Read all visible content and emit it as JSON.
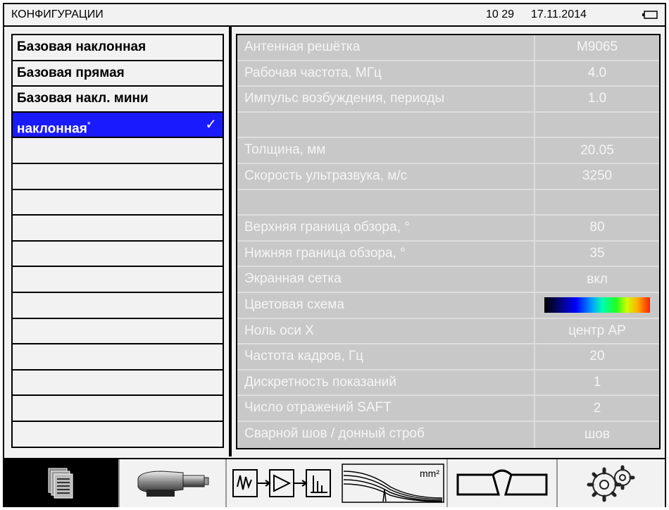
{
  "header": {
    "title": "КОНФИГУРАЦИИ",
    "time": "10 29",
    "date": "17.11.2014"
  },
  "configs": [
    {
      "label": "Базовая наклонная",
      "star": "",
      "check": ""
    },
    {
      "label": "Базовая прямая",
      "star": "",
      "check": ""
    },
    {
      "label": "Базовая накл. мини",
      "star": "",
      "check": ""
    },
    {
      "label": "наклонная",
      "star": "*",
      "check": "✓"
    },
    {
      "label": ""
    },
    {
      "label": ""
    },
    {
      "label": ""
    },
    {
      "label": ""
    },
    {
      "label": ""
    },
    {
      "label": ""
    },
    {
      "label": ""
    },
    {
      "label": ""
    },
    {
      "label": ""
    },
    {
      "label": ""
    },
    {
      "label": ""
    },
    {
      "label": ""
    }
  ],
  "params": [
    {
      "name": "Антенная решётка",
      "value": "M9065"
    },
    {
      "name": "Рабочая частота, МГц",
      "value": "4.0"
    },
    {
      "name": "Импульс возбуждения, периоды",
      "value": "1.0"
    },
    {
      "name": "",
      "value": ""
    },
    {
      "name": "Толщина, мм",
      "value": "20.05"
    },
    {
      "name": "Скорость ультразвука, м/с",
      "value": "3250"
    },
    {
      "name": "",
      "value": ""
    },
    {
      "name": "Верхняя граница обзора, °",
      "value": "80"
    },
    {
      "name": "Нижняя граница обзора, °",
      "value": "35"
    },
    {
      "name": "Экранная сетка",
      "value": "вкл"
    },
    {
      "name": "Цветовая схема",
      "value": ""
    },
    {
      "name": "Ноль оси X",
      "value": "центр АР"
    },
    {
      "name": "Частота кадров, Гц",
      "value": "20"
    },
    {
      "name": "Дискретность показаний",
      "value": "1"
    },
    {
      "name": "Число отражений SAFT",
      "value": "2"
    },
    {
      "name": "Сварной шов / донный строб",
      "value": "шов"
    }
  ],
  "toolbar": {
    "unit_label": "mm²",
    "icons": [
      "documents-icon",
      "probe-icon",
      "signal-chain-icon",
      "waveform-icon",
      "weld-icon",
      "settings-icon"
    ]
  },
  "colors": {
    "selected": "#1a1aff",
    "panel": "#f2f2f2",
    "param_bg": "#c8c8c8"
  }
}
